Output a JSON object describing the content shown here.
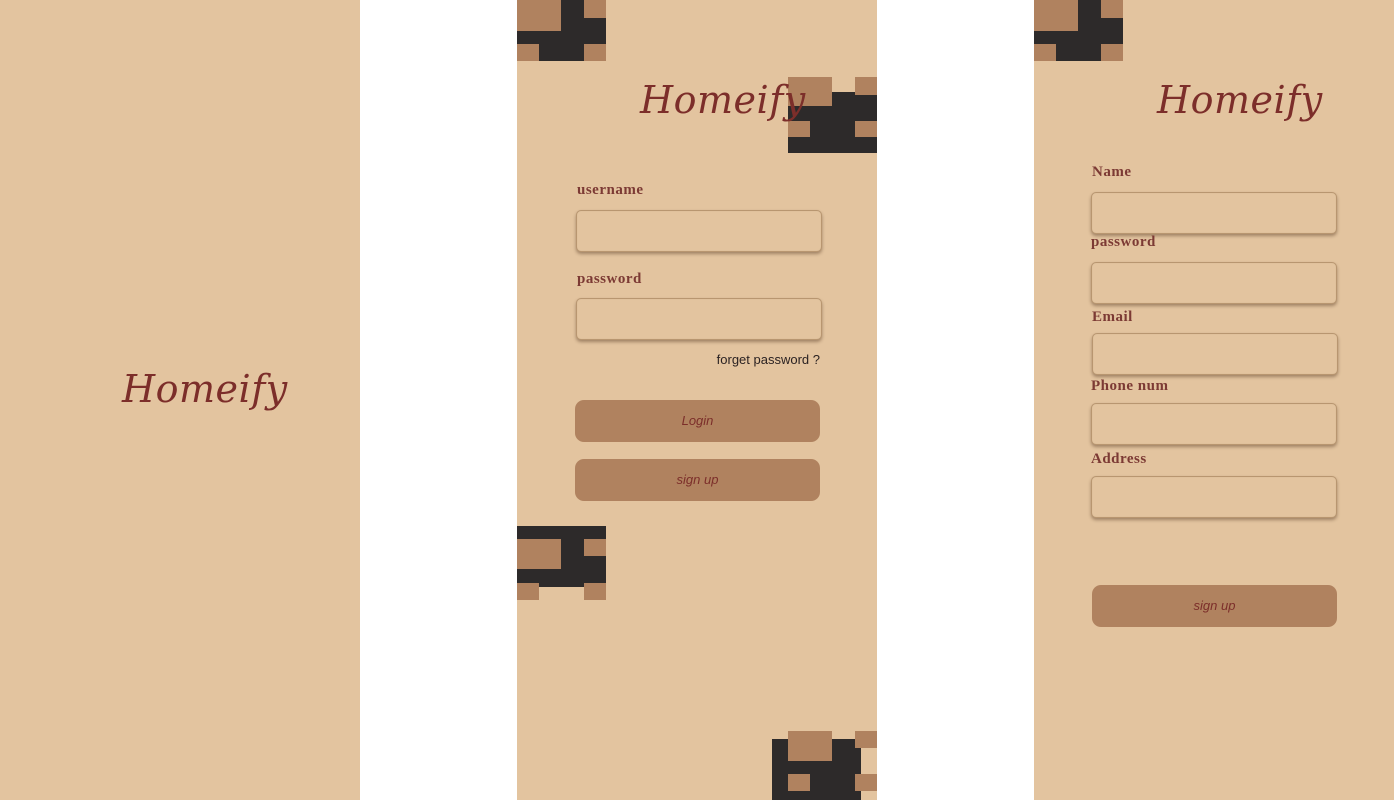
{
  "splash": {
    "logo": "Homeify"
  },
  "login": {
    "logo": "Homeify",
    "username_label": "username",
    "username_value": "",
    "password_label": "password",
    "password_value": "",
    "forgot_link": "forget password ?",
    "login_button": "Login",
    "signup_button": "sign up"
  },
  "signup": {
    "logo": "Homeify",
    "fields": [
      {
        "label": "Name",
        "value": ""
      },
      {
        "label": "password",
        "value": ""
      },
      {
        "label": "Email",
        "value": ""
      },
      {
        "label": "Phone num",
        "value": ""
      },
      {
        "label": "Address",
        "value": ""
      }
    ],
    "signup_button": "sign up"
  },
  "colors": {
    "background": "#e3c49f",
    "accent": "#b0825f",
    "dark": "#2d2a2a",
    "text": "#7c2e2a"
  }
}
